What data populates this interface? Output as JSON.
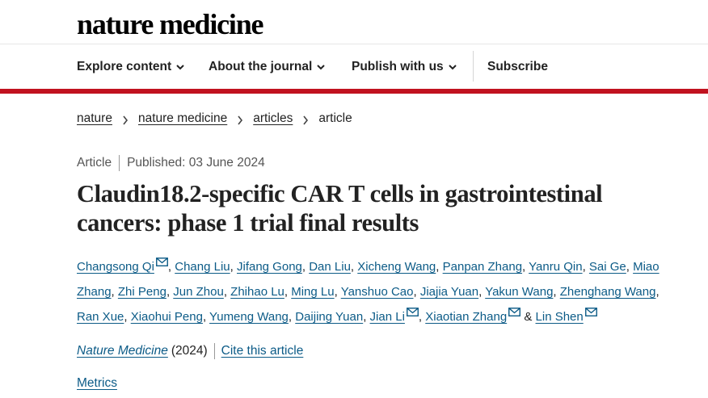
{
  "header": {
    "logo": "nature medicine"
  },
  "nav": {
    "items": [
      {
        "label": "Explore content",
        "dropdown": true
      },
      {
        "label": "About the journal",
        "dropdown": true
      },
      {
        "label": "Publish with us",
        "dropdown": true
      },
      {
        "label": "Subscribe",
        "dropdown": false
      }
    ]
  },
  "breadcrumb": [
    "nature",
    "nature medicine",
    "articles",
    "article"
  ],
  "article": {
    "type": "Article",
    "published": "Published: 03 June 2024",
    "title": "Claudin18.2-specific CAR T cells in gastrointestinal cancers: phase 1 trial final results",
    "authors": [
      {
        "name": "Changsong Qi",
        "email": true
      },
      {
        "name": "Chang Liu",
        "email": false
      },
      {
        "name": "Jifang Gong",
        "email": false
      },
      {
        "name": "Dan Liu",
        "email": false
      },
      {
        "name": "Xicheng Wang",
        "email": false
      },
      {
        "name": "Panpan Zhang",
        "email": false
      },
      {
        "name": "Yanru Qin",
        "email": false
      },
      {
        "name": "Sai Ge",
        "email": false
      },
      {
        "name": "Miao Zhang",
        "email": false
      },
      {
        "name": "Zhi Peng",
        "email": false
      },
      {
        "name": "Jun Zhou",
        "email": false
      },
      {
        "name": "Zhihao Lu",
        "email": false
      },
      {
        "name": "Ming Lu",
        "email": false
      },
      {
        "name": "Yanshuo Cao",
        "email": false
      },
      {
        "name": "Jiajia Yuan",
        "email": false
      },
      {
        "name": "Yakun Wang",
        "email": false
      },
      {
        "name": "Zhenghang Wang",
        "email": false
      },
      {
        "name": "Ran Xue",
        "email": false
      },
      {
        "name": "Xiaohui Peng",
        "email": false
      },
      {
        "name": "Yumeng Wang",
        "email": false
      },
      {
        "name": "Daijing Yuan",
        "email": false
      },
      {
        "name": "Jian Li",
        "email": true
      },
      {
        "name": "Xiaotian Zhang",
        "email": true
      },
      {
        "name": "Lin Shen",
        "email": true
      }
    ],
    "author_separator": ",",
    "last_author_separator": "&",
    "journal": "Nature Medicine",
    "year": "(2024)",
    "cite_label": "Cite this article",
    "metrics_label": "Metrics"
  },
  "colors": {
    "accent_red": "#c1121f",
    "link_blue": "#0c5b87"
  },
  "icons": {
    "dropdown": "chevron-down-icon",
    "breadcrumb_separator": "chevron-right-icon",
    "email": "mail-icon"
  }
}
